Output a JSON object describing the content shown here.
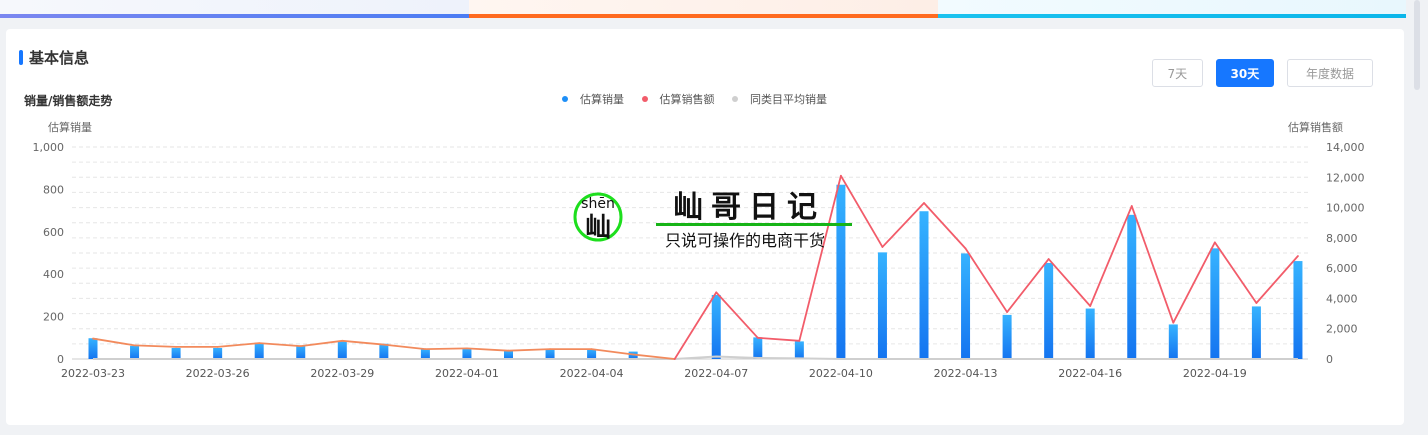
{
  "section_title": "基本信息",
  "buttons": [
    "7天",
    "30天",
    "年度数据"
  ],
  "active_button": "30天",
  "watermark": {
    "pinyin": "shēn",
    "logo_char": "屾",
    "name": "屾哥日记",
    "slogan": "只说可操作的电商干货"
  },
  "colors": {
    "accent": "#1677ff",
    "sales_line": "#f25c6a",
    "avg_line": "#cfcfcf"
  },
  "chart_data": {
    "type": "bar",
    "title": "销量/销售额走势",
    "ylabel": "估算销量",
    "y2label": "估算销售额",
    "ylim": [
      0,
      1000
    ],
    "y2lim": [
      0,
      14000
    ],
    "yticks": [
      "0",
      "200",
      "400",
      "600",
      "800",
      "1,000"
    ],
    "y2ticks": [
      "0",
      "2,000",
      "4,000",
      "6,000",
      "8,000",
      "10,000",
      "12,000",
      "14,000"
    ],
    "x": [
      "2022-03-23",
      "2022-03-24",
      "2022-03-25",
      "2022-03-26",
      "2022-03-27",
      "2022-03-28",
      "2022-03-29",
      "2022-03-30",
      "2022-03-31",
      "2022-04-01",
      "2022-04-02",
      "2022-04-03",
      "2022-04-04",
      "2022-04-05",
      "2022-04-06",
      "2022-04-07",
      "2022-04-08",
      "2022-04-09",
      "2022-04-10",
      "2022-04-11",
      "2022-04-12",
      "2022-04-13",
      "2022-04-14",
      "2022-04-15",
      "2022-04-16",
      "2022-04-17",
      "2022-04-18",
      "2022-04-19",
      "2022-04-20",
      "2022-04-21"
    ],
    "xtick_labels": [
      "2022-03-23",
      "2022-03-26",
      "2022-03-29",
      "2022-04-01",
      "2022-04-04",
      "2022-04-07",
      "2022-04-10",
      "2022-04-13",
      "2022-04-16",
      "2022-04-19"
    ],
    "series": [
      {
        "name": "估算销量",
        "type": "bar",
        "axis": "left",
        "color": "#1e8ff7",
        "values": [
          98,
          62,
          52,
          52,
          74,
          62,
          85,
          72,
          47,
          50,
          40,
          49,
          46,
          35,
          0,
          302,
          102,
          83,
          822,
          503,
          697,
          498,
          208,
          453,
          238,
          680,
          163,
          522,
          248,
          462
        ]
      },
      {
        "name": "估算销售额",
        "type": "line",
        "axis": "right",
        "color": "#f25c6a",
        "values": [
          1350,
          900,
          800,
          800,
          1050,
          850,
          1200,
          950,
          650,
          700,
          550,
          650,
          650,
          300,
          0,
          4400,
          1400,
          1200,
          12100,
          7400,
          10300,
          7300,
          3100,
          6600,
          3500,
          10100,
          2400,
          7700,
          3700,
          6800
        ]
      },
      {
        "name": "同类目平均销量",
        "type": "line",
        "axis": "left",
        "color": "#cfcfcf",
        "values": [
          0,
          0,
          0,
          0,
          0,
          0,
          0,
          0,
          0,
          0,
          0,
          0,
          0,
          0,
          0,
          12,
          5,
          3,
          0,
          0,
          0,
          0,
          0,
          0,
          0,
          0,
          0,
          0,
          0,
          0
        ]
      }
    ],
    "legend_position": "top-center",
    "grid": true
  }
}
